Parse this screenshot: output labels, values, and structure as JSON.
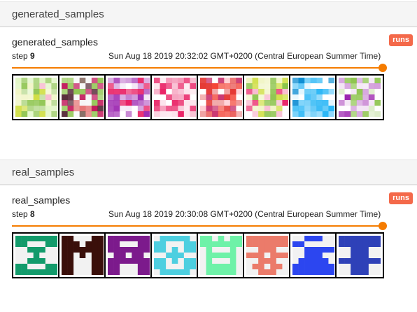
{
  "sections": [
    {
      "header": "generated_samples",
      "card": {
        "title": "generated_samples",
        "runs_badge": "runs",
        "step_label": "step",
        "step_value": "9",
        "timestamp": "Sun Aug 18 2019 20:32:02 GMT+0200 (Central European Summer Time)",
        "slider_fraction": 1.0,
        "images": [
          {
            "kind": "blurry",
            "palette": [
              "#8bc34a",
              "#cddc39",
              "#e1f5c4",
              "#f0f4c3",
              "#aed581",
              "#f8bbd0"
            ]
          },
          {
            "kind": "blurry",
            "palette": [
              "#4a1a2a",
              "#c2185b",
              "#8bc34a",
              "#f5f5f5",
              "#6d4c41",
              "#e57373"
            ]
          },
          {
            "kind": "blurry",
            "palette": [
              "#9c27b0",
              "#ce93d8",
              "#e91e63",
              "#f3e5f5",
              "#ba68c8",
              "#ffffff"
            ]
          },
          {
            "kind": "blurry",
            "palette": [
              "#e91e63",
              "#f48fb1",
              "#fce4ec",
              "#ffffff",
              "#ec407a",
              "#f8bbd0"
            ]
          },
          {
            "kind": "blurry",
            "palette": [
              "#e53935",
              "#f44336",
              "#c2185b",
              "#ffcdd2",
              "#ef9a9a",
              "#ffffff"
            ]
          },
          {
            "kind": "blurry",
            "palette": [
              "#cddc39",
              "#8bc34a",
              "#f0f4c3",
              "#f8bbd0",
              "#ffffff",
              "#e91e63"
            ]
          },
          {
            "kind": "blurry",
            "palette": [
              "#29b6f6",
              "#81d4fa",
              "#4fc3f7",
              "#ffffff",
              "#e1f5fe",
              "#0288d1"
            ]
          },
          {
            "kind": "blurry",
            "palette": [
              "#8bc34a",
              "#ce93d8",
              "#f3e5f5",
              "#ffffff",
              "#dcedc8",
              "#9c27b0"
            ]
          }
        ]
      }
    },
    {
      "header": "real_samples",
      "card": {
        "title": "real_samples",
        "runs_badge": "runs",
        "step_label": "step",
        "step_value": "8",
        "timestamp": "Sun Aug 18 2019 20:30:08 GMT+0200 (Central European Summer Time)",
        "slider_fraction": 1.0,
        "images": [
          {
            "kind": "pixel",
            "color": "#129b6b"
          },
          {
            "kind": "pixel",
            "color": "#3a0f0a"
          },
          {
            "kind": "pixel",
            "color": "#7c1a8c"
          },
          {
            "kind": "pixel",
            "color": "#4dcfe0"
          },
          {
            "kind": "pixel",
            "color": "#6ef2a8"
          },
          {
            "kind": "pixel",
            "color": "#eb7b6a"
          },
          {
            "kind": "pixel",
            "color": "#2c46f0"
          },
          {
            "kind": "pixel",
            "color": "#2e41b8"
          }
        ]
      }
    }
  ]
}
